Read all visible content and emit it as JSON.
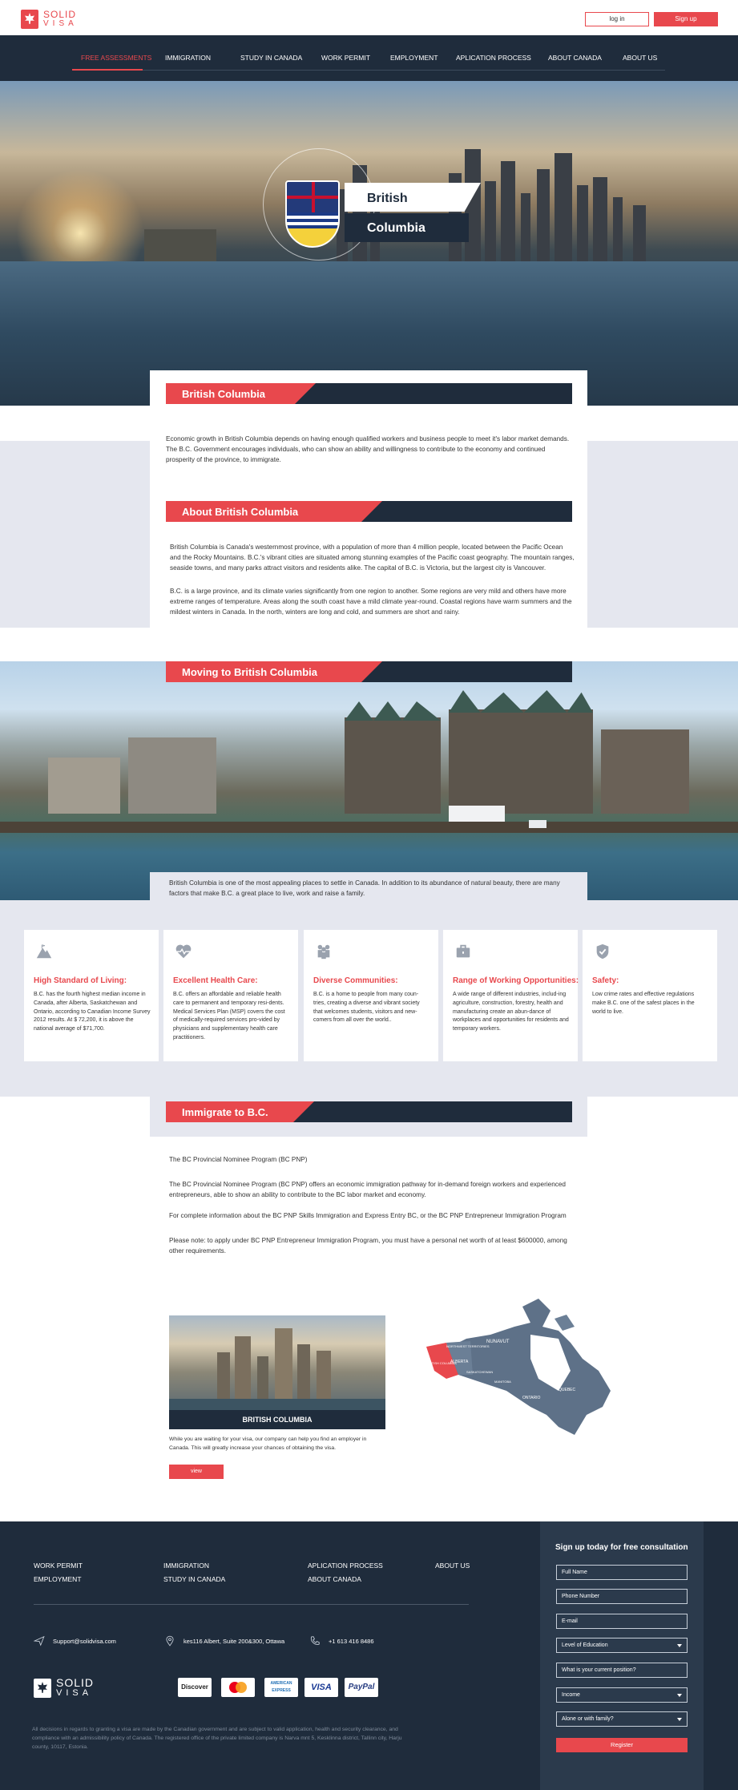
{
  "header": {
    "logo_top": "SOLID",
    "logo_bottom": "VISA",
    "login_label": "log in",
    "signup_label": "Sign up"
  },
  "nav": {
    "items": [
      {
        "label": "FREE ASSESSMENTS",
        "active": true
      },
      {
        "label": "IMMIGRATION",
        "active": false
      },
      {
        "label": "STUDY IN CANADA",
        "active": false
      },
      {
        "label": "WORK PERMIT",
        "active": false
      },
      {
        "label": "EMPLOYMENT",
        "active": false
      },
      {
        "label": "APLICATION PROCESS",
        "active": false
      },
      {
        "label": "ABOUT CANADA",
        "active": false
      },
      {
        "label": "ABOUT US",
        "active": false
      }
    ]
  },
  "hero": {
    "title_line1": "British",
    "title_line2": "Columbia"
  },
  "intro": {
    "heading": "British Columbia",
    "text": "Economic growth in British Columbia depends on having enough qualified workers and business people to meet it's labor market demands. The B.C. Government encourages individuals, who can show an ability and willingness to contribute to the economy and continued prosperity of the province, to immigrate."
  },
  "about": {
    "heading": "About British Columbia",
    "p1": "British Columbia is Canada's westernmost province, with a population of more than 4 million people, located between the Pacific Ocean and the Rocky Mountains. B.C.'s vibrant cities are situated among stunning examples of the Pacific coast geography. The mountain ranges, seaside towns, and many parks attract visitors and residents alike. The capital of B.C. is Victoria, but the largest city is Vancouver.",
    "p2": "B.C. is a large province, and its climate varies significantly from one region to another. Some regions are very mild and others have more extreme ranges of temperature. Areas along the south coast have a mild climate year-round. Coastal regions have warm summers and the mildest winters in Canada. In the north, winters are long and cold, and summers are short and rainy."
  },
  "moving": {
    "heading": "Moving to British Columbia",
    "caption": "British Columbia is one of the most appealing places to settle in Canada. In addition to its abundance of natural beauty, there are many factors that make B.C. a great place to live, work and raise a family."
  },
  "features": [
    {
      "icon": "mountain-icon",
      "title": "High Standard of Living:",
      "text": " B.C. has the fourth highest median income in Canada, after Alberta, Saskatchewan and Ontario, according to Canadian Income Survey 2012 results. At $ 72,200, it is above the national average of $71,700."
    },
    {
      "icon": "heart-pulse-icon",
      "title": "Excellent Health Care:",
      "text": "B.C. offers an affordable and reliable health care to permanent and temporary resi-dents. Medical Services Plan (MSP) covers the cost of medically-required services pro-vided by physicians and supplementary health care practitioners."
    },
    {
      "icon": "people-icon",
      "title": "Diverse Communities:",
      "text": "B.C. is a home to people from many coun-tries, creating a diverse and vibrant society that welcomes students, visitors and new-comers from all over the world.."
    },
    {
      "icon": "briefcase-icon",
      "title": "Range of Working Opportunities:",
      "text": "A wide range of different industries, includ-ing agriculture, construction, forestry, health and manufacturing create an abun-dance of workplaces and opportunities for residents and temporary workers."
    },
    {
      "icon": "shield-check-icon",
      "title": "Safety:",
      "text": "Low crime rates and effective regulations make B.C. one of the safest places in the world to live."
    }
  ],
  "immigrate": {
    "heading": "Immigrate to B.C.",
    "p1": "The BC Provincial Nominee Program (BC PNP)",
    "p2": "The BC Provincial Nominee Program (BC PNP) offers an economic immigration pathway for in-demand foreign workers and experienced entrepreneurs, able to show an ability to contribute to the BC labor market and economy.",
    "p3": "For complete information about the BC PNP Skills Immigration and Express Entry BC, or the BC PNP Entrepreneur Immigration Program",
    "p4": "Please note: to apply under BC PNP Entrepreneur Immigration Program, you must have a personal net worth of at least $600000, among other requirements."
  },
  "bc_card": {
    "caption": "BRITISH COLUMBIA",
    "text": "While you are waiting for your visa, our company can help you find an employer in Canada. This will greatly increase your chances of obtaining the visa.",
    "button": "view"
  },
  "map": {
    "labels": [
      "YUKON",
      "NORTHWEST TERRITORIES",
      "NUNAVUT",
      "BRITISH COLUMBIA",
      "ALBERTA",
      "SASKATCHEWAN",
      "MANITOBA",
      "ONTARIO",
      "QUEBEC"
    ],
    "highlight_color": "#e8484d"
  },
  "footer": {
    "links_col1": [
      "WORK PERMIT",
      "EMPLOYMENT"
    ],
    "links_col2": [
      "IMMIGRATION",
      "STUDY IN CANADA"
    ],
    "links_col3": [
      "APLICATION PROCESS",
      "ABOUT CANADA"
    ],
    "links_col4": [
      "ABOUT US"
    ],
    "email": "Support@solidvisa.com",
    "address": "kes116 Albert, Suite 200&300, Ottawa",
    "phone": "+1 613 416 8486",
    "logo_top": "SOLID",
    "logo_bottom": "VISA",
    "payments": [
      "Discover",
      "MasterCard",
      "AMERICAN EXPRESS",
      "VISA",
      "PayPal"
    ],
    "disclaimer": "All decisions in regards to granting a visa are made by the Canadian government and are subject to valid application, health and security clearance, and compliance with an admissibility policy of Canada. The registered office of the private limited company is Narva mnt 5, Kesklinna district, Tallinn city, Harju county, 10117, Estonia."
  },
  "signup": {
    "title": "Sign up today for free consultation",
    "fields": [
      {
        "placeholder": "Full Name",
        "dropdown": false
      },
      {
        "placeholder": "Phone Number",
        "dropdown": false
      },
      {
        "placeholder": "E-mail",
        "dropdown": false
      },
      {
        "placeholder": "Level of Education",
        "dropdown": true
      },
      {
        "placeholder": "What is your current position?",
        "dropdown": false
      },
      {
        "placeholder": "Income",
        "dropdown": true
      },
      {
        "placeholder": "Alone or with family?",
        "dropdown": true
      }
    ],
    "button": "Register"
  },
  "colors": {
    "accent": "#e8484d",
    "navy": "#1f2c3c",
    "gray_bg": "#e5e7ef"
  }
}
